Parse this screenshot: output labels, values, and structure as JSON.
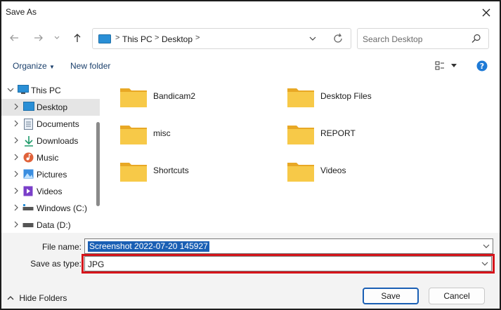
{
  "window": {
    "title": "Save As"
  },
  "address": {
    "segments": [
      "This PC",
      "Desktop"
    ]
  },
  "search": {
    "placeholder": "Search Desktop"
  },
  "toolbar": {
    "organize": "Organize",
    "new_folder": "New folder"
  },
  "tree": [
    {
      "label": "This PC",
      "icon": "pc-icon",
      "expanded": true
    },
    {
      "label": "Desktop",
      "icon": "desktop-icon",
      "selected": true
    },
    {
      "label": "Documents",
      "icon": "documents-icon"
    },
    {
      "label": "Downloads",
      "icon": "downloads-icon"
    },
    {
      "label": "Music",
      "icon": "music-icon"
    },
    {
      "label": "Pictures",
      "icon": "pictures-icon"
    },
    {
      "label": "Videos",
      "icon": "videos-icon"
    },
    {
      "label": "Windows (C:)",
      "icon": "drive-icon"
    },
    {
      "label": "Data (D:)",
      "icon": "drive-icon"
    }
  ],
  "folders": [
    "Bandicam2",
    "Desktop Files",
    "misc",
    "REPORT",
    "Shortcuts",
    "Videos"
  ],
  "form": {
    "file_name_label": "File name:",
    "file_name_value": "Screenshot 2022-07-20 145927",
    "type_label": "Save as type:",
    "type_value": "JPG"
  },
  "footer": {
    "hide_folders": "Hide Folders",
    "save": "Save",
    "cancel": "Cancel"
  },
  "colors": {
    "accent": "#1a5fb4",
    "highlight": "#d6141b",
    "folder": "#f5c343",
    "help": "#1e7ad6"
  }
}
